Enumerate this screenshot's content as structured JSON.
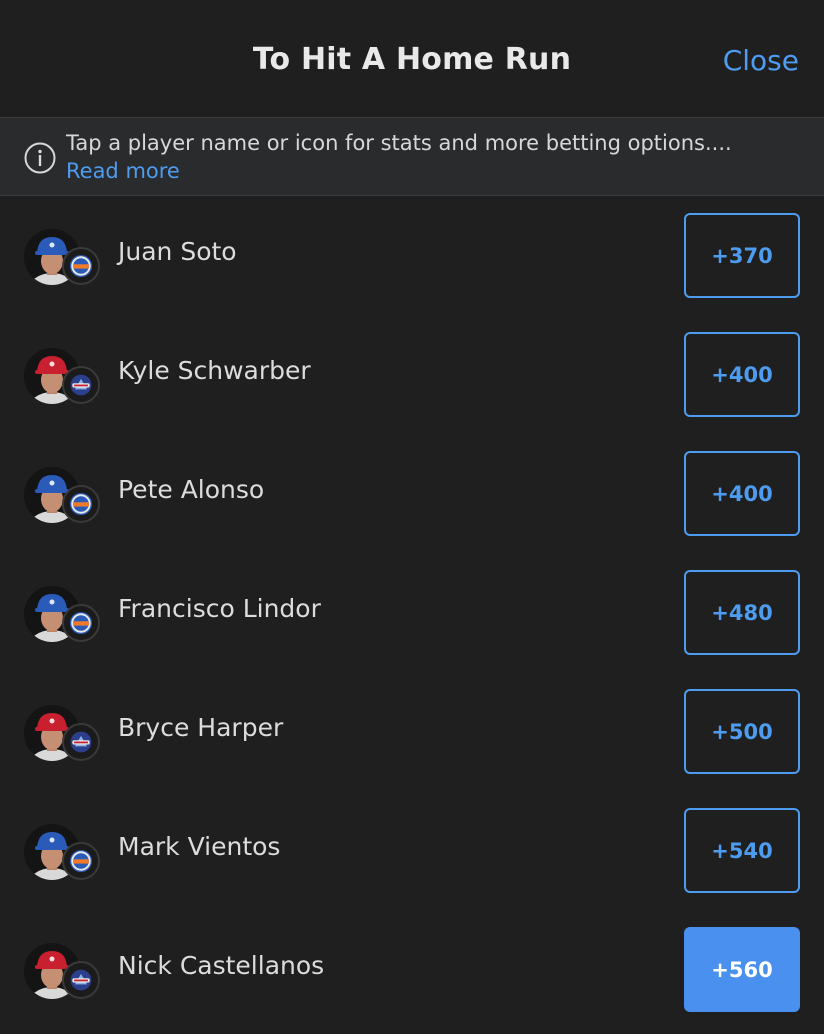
{
  "header": {
    "title": "To Hit A Home Run",
    "close_label": "Close"
  },
  "info": {
    "text": "Tap a player name or icon for stats and more betting options.... ",
    "read_more": "Read more"
  },
  "colors": {
    "accent": "#4d9cf0",
    "selected_bg": "#4a90ee",
    "background": "#1f1f1f",
    "mets_cap": "#2a5bb8",
    "phillies_cap": "#c8202f"
  },
  "players": [
    {
      "name": "Juan Soto",
      "odds": "+370",
      "team": "mets",
      "selected": false
    },
    {
      "name": "Kyle Schwarber",
      "odds": "+400",
      "team": "phillies",
      "selected": false
    },
    {
      "name": "Pete Alonso",
      "odds": "+400",
      "team": "mets",
      "selected": false
    },
    {
      "name": "Francisco Lindor",
      "odds": "+480",
      "team": "mets",
      "selected": false
    },
    {
      "name": "Bryce Harper",
      "odds": "+500",
      "team": "phillies",
      "selected": false
    },
    {
      "name": "Mark Vientos",
      "odds": "+540",
      "team": "mets",
      "selected": false
    },
    {
      "name": "Nick Castellanos",
      "odds": "+560",
      "team": "phillies",
      "selected": true
    }
  ]
}
